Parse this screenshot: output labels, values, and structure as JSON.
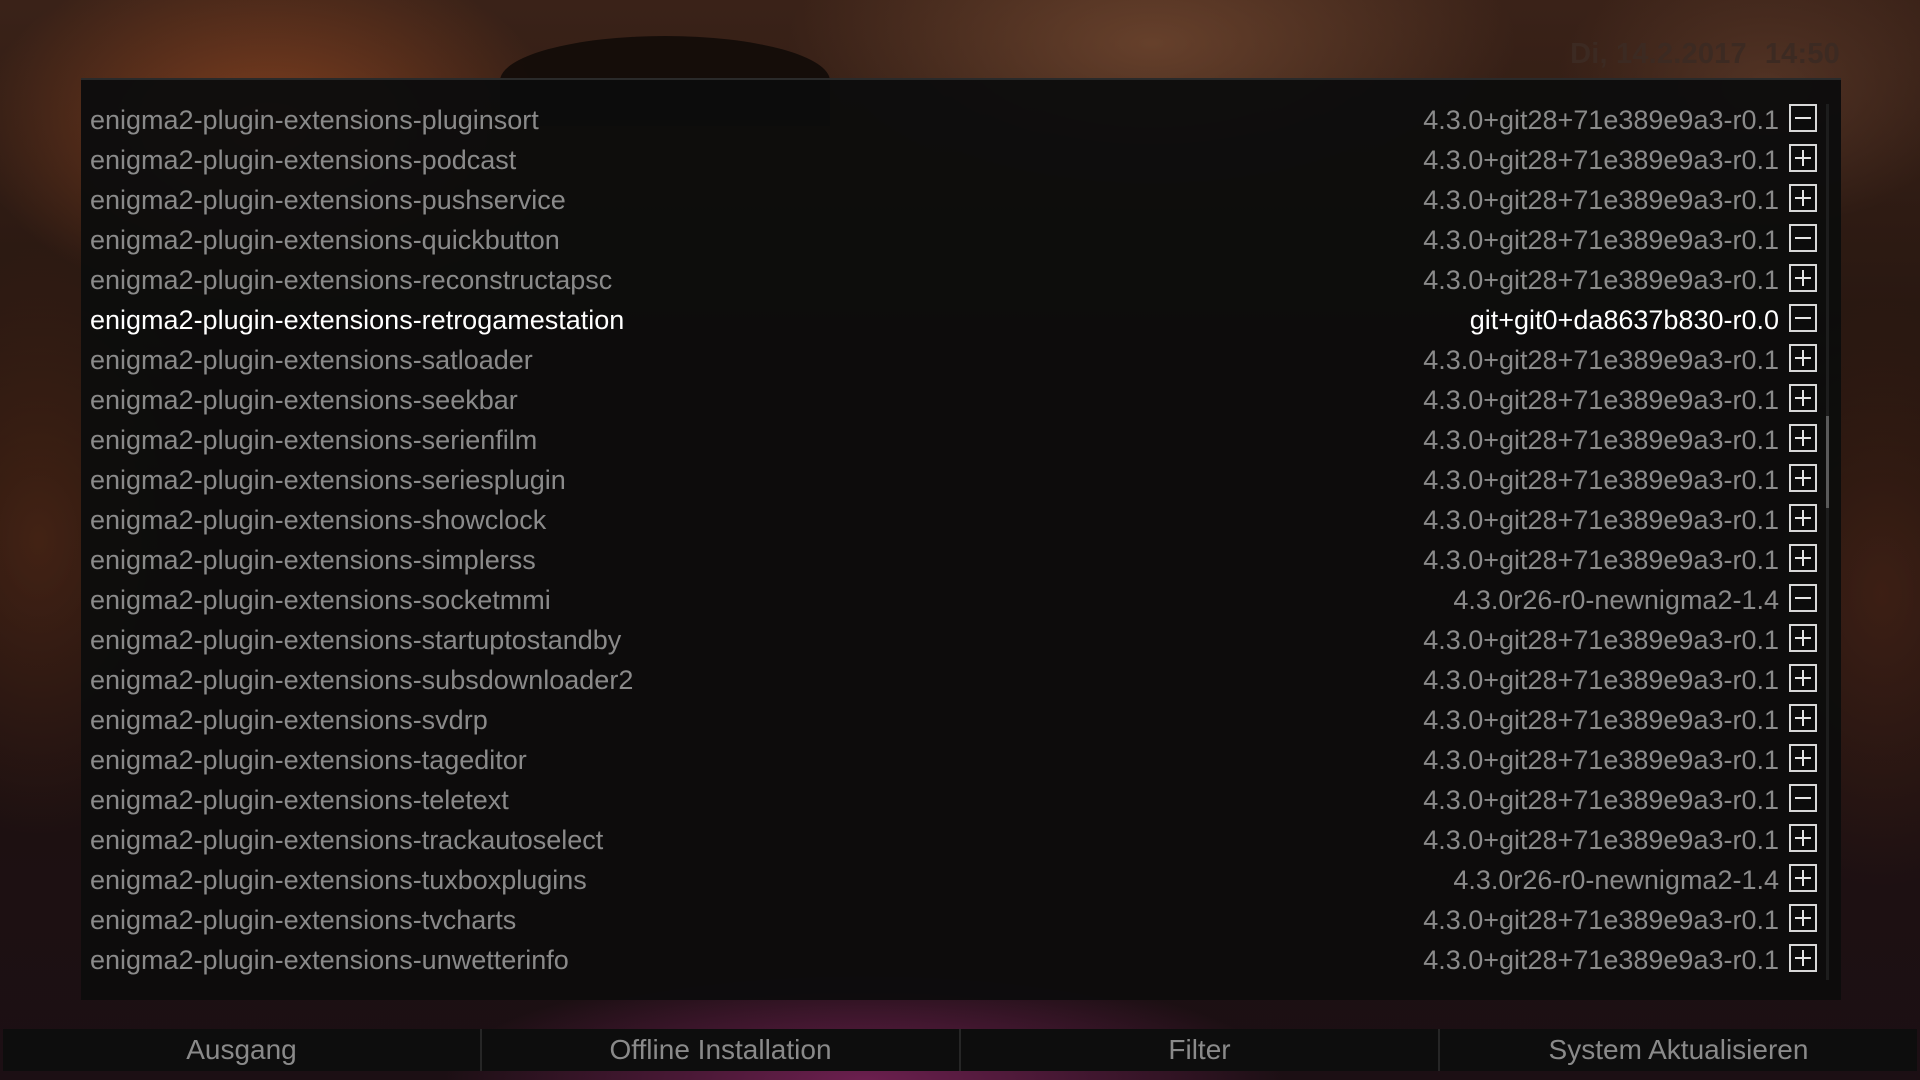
{
  "header": {
    "date": "Di, 14.2.2017",
    "time": "14:50"
  },
  "packages": [
    {
      "name": "enigma2-plugin-extensions-pluginsort",
      "version": "4.3.0+git28+71e389e9a3-r0.1",
      "status": "minus"
    },
    {
      "name": "enigma2-plugin-extensions-podcast",
      "version": "4.3.0+git28+71e389e9a3-r0.1",
      "status": "plus"
    },
    {
      "name": "enigma2-plugin-extensions-pushservice",
      "version": "4.3.0+git28+71e389e9a3-r0.1",
      "status": "plus"
    },
    {
      "name": "enigma2-plugin-extensions-quickbutton",
      "version": "4.3.0+git28+71e389e9a3-r0.1",
      "status": "minus"
    },
    {
      "name": "enigma2-plugin-extensions-reconstructapsc",
      "version": "4.3.0+git28+71e389e9a3-r0.1",
      "status": "plus"
    },
    {
      "name": "enigma2-plugin-extensions-retrogamestation",
      "version": "git+git0+da8637b830-r0.0",
      "status": "minus",
      "selected": true
    },
    {
      "name": "enigma2-plugin-extensions-satloader",
      "version": "4.3.0+git28+71e389e9a3-r0.1",
      "status": "plus"
    },
    {
      "name": "enigma2-plugin-extensions-seekbar",
      "version": "4.3.0+git28+71e389e9a3-r0.1",
      "status": "plus"
    },
    {
      "name": "enigma2-plugin-extensions-serienfilm",
      "version": "4.3.0+git28+71e389e9a3-r0.1",
      "status": "plus"
    },
    {
      "name": "enigma2-plugin-extensions-seriesplugin",
      "version": "4.3.0+git28+71e389e9a3-r0.1",
      "status": "plus"
    },
    {
      "name": "enigma2-plugin-extensions-showclock",
      "version": "4.3.0+git28+71e389e9a3-r0.1",
      "status": "plus"
    },
    {
      "name": "enigma2-plugin-extensions-simplerss",
      "version": "4.3.0+git28+71e389e9a3-r0.1",
      "status": "plus"
    },
    {
      "name": "enigma2-plugin-extensions-socketmmi",
      "version": "4.3.0r26-r0-newnigma2-1.4",
      "status": "minus"
    },
    {
      "name": "enigma2-plugin-extensions-startuptostandby",
      "version": "4.3.0+git28+71e389e9a3-r0.1",
      "status": "plus"
    },
    {
      "name": "enigma2-plugin-extensions-subsdownloader2",
      "version": "4.3.0+git28+71e389e9a3-r0.1",
      "status": "plus"
    },
    {
      "name": "enigma2-plugin-extensions-svdrp",
      "version": "4.3.0+git28+71e389e9a3-r0.1",
      "status": "plus"
    },
    {
      "name": "enigma2-plugin-extensions-tageditor",
      "version": "4.3.0+git28+71e389e9a3-r0.1",
      "status": "plus"
    },
    {
      "name": "enigma2-plugin-extensions-teletext",
      "version": "4.3.0+git28+71e389e9a3-r0.1",
      "status": "minus"
    },
    {
      "name": "enigma2-plugin-extensions-trackautoselect",
      "version": "4.3.0+git28+71e389e9a3-r0.1",
      "status": "plus"
    },
    {
      "name": "enigma2-plugin-extensions-tuxboxplugins",
      "version": "4.3.0r26-r0-newnigma2-1.4",
      "status": "plus"
    },
    {
      "name": "enigma2-plugin-extensions-tvcharts",
      "version": "4.3.0+git28+71e389e9a3-r0.1",
      "status": "plus"
    },
    {
      "name": "enigma2-plugin-extensions-unwetterinfo",
      "version": "4.3.0+git28+71e389e9a3-r0.1",
      "status": "plus"
    }
  ],
  "buttons": {
    "exit": "Ausgang",
    "offline_install": "Offline Installation",
    "filter": "Filter",
    "system_update": "System Aktualisieren"
  },
  "colors": {
    "selected_text": "#ffffff",
    "normal_text": "#8a8a8a",
    "panel_background": "#0c0c0c"
  }
}
